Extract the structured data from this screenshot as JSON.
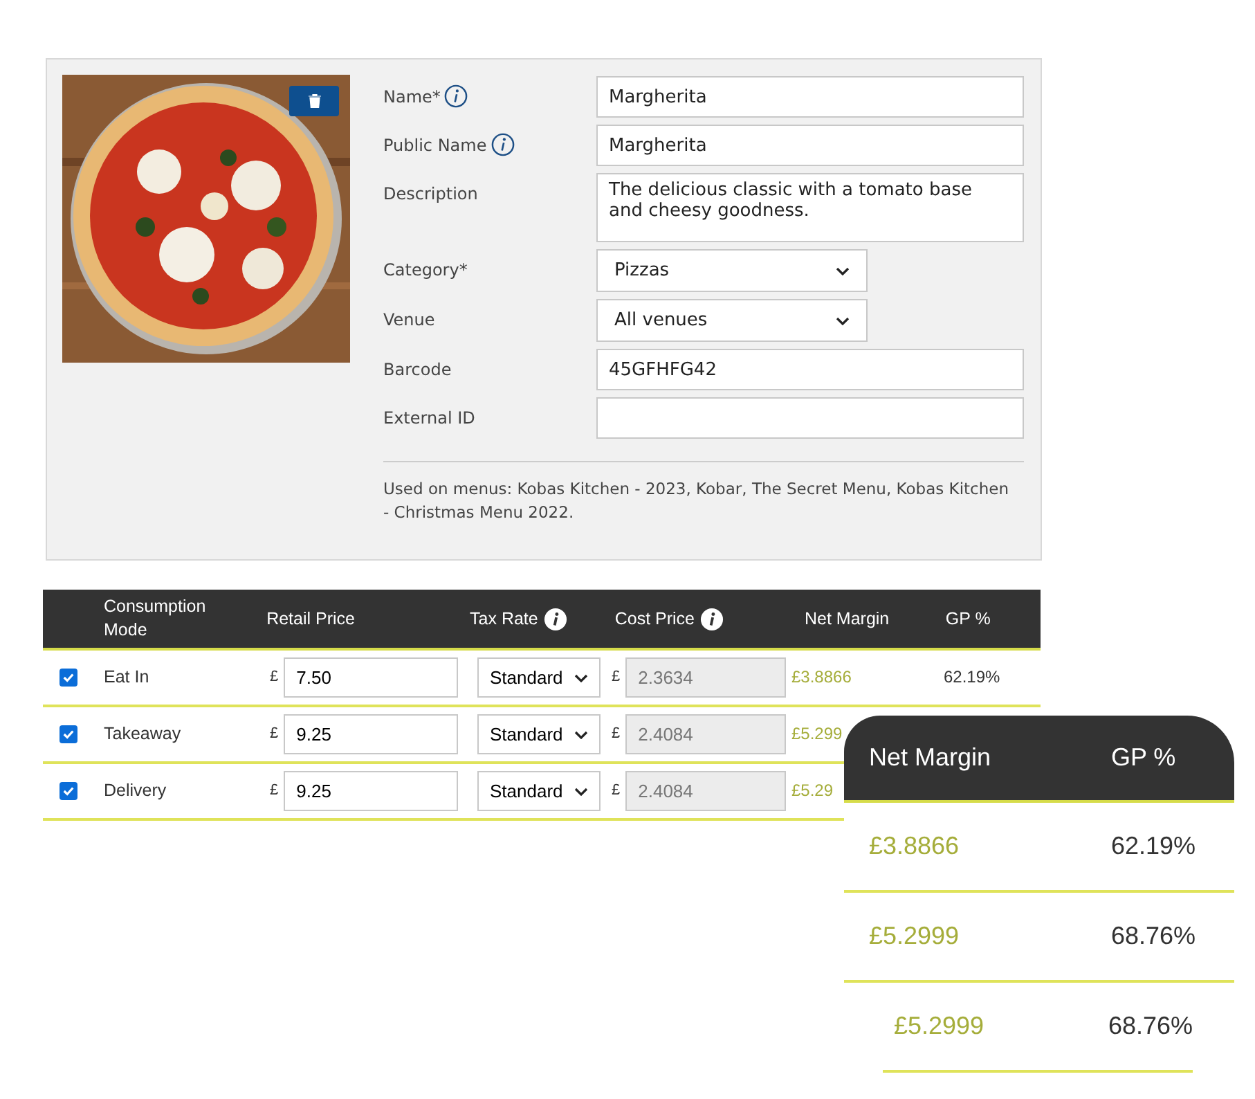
{
  "product": {
    "fields": [
      {
        "kind": "text",
        "label": "Name*",
        "info": true,
        "value": "Margherita"
      },
      {
        "kind": "text",
        "label": "Public Name",
        "info": true,
        "value": "Margherita"
      },
      {
        "kind": "textarea",
        "label": "Description",
        "info": false,
        "value": "The delicious classic with a tomato base and cheesy goodness."
      },
      {
        "kind": "select",
        "label": "Category*",
        "info": false,
        "value": "Pizzas"
      },
      {
        "kind": "select",
        "label": "Venue",
        "info": false,
        "value": "All venues"
      },
      {
        "kind": "text",
        "label": "Barcode",
        "info": false,
        "value": "45GFHFG42"
      },
      {
        "kind": "text",
        "label": "External ID",
        "info": false
      }
    ],
    "used_on": "Used on menus: Kobas Kitchen - 2023, Kobar, The Secret Menu, Kobas Kitchen - Christmas Menu 2022."
  },
  "table": {
    "columns": [
      {
        "label": "Consumption Mode",
        "info": false
      },
      {
        "label": "Retail Price",
        "info": false
      },
      {
        "label": "Tax Rate",
        "info": true
      },
      {
        "label": "Cost Price",
        "info": true
      },
      {
        "label": "Net Margin",
        "info": false
      },
      {
        "label": "GP %",
        "info": false
      }
    ],
    "rows": [
      {
        "checked": true,
        "mode": "Eat In",
        "currency": "£",
        "retail": "7.50",
        "tax": "Standard",
        "cost": "2.3634",
        "cost_disabled": true,
        "net_margin": "£3.8866",
        "gp": "62.19%"
      },
      {
        "checked": true,
        "mode": "Takeaway",
        "currency": "£",
        "retail": "9.25",
        "tax": "Standard",
        "cost": "2.4084",
        "cost_disabled": true,
        "net_margin": "£5.299"
      },
      {
        "checked": true,
        "mode": "Delivery",
        "currency": "£",
        "retail": "9.25",
        "tax": "Standard",
        "cost": "2.4084",
        "cost_disabled": true,
        "net_margin": "£5.29"
      }
    ]
  },
  "zoom_callout": {
    "columns": [
      "Net Margin",
      "GP %"
    ],
    "rows": [
      {
        "net_margin": "£3.8866",
        "gp": "62.19%"
      },
      {
        "net_margin": "£5.2999",
        "gp": "68.76%"
      },
      {
        "net_margin": "£5.2999",
        "gp": "68.76%"
      }
    ]
  }
}
